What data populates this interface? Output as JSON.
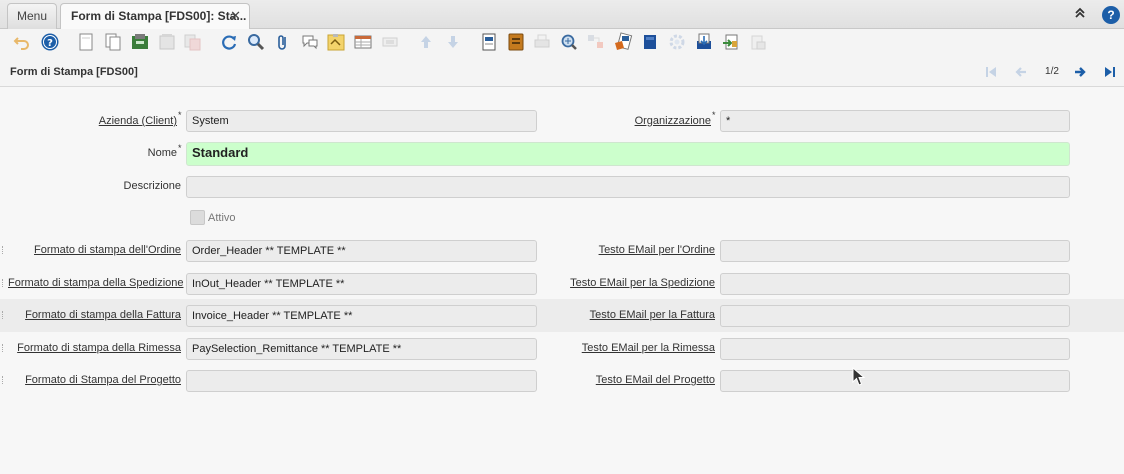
{
  "tabs": {
    "menu": "Menu",
    "active": "Form di Stampa [FDS00]: Sta...",
    "close": "✕"
  },
  "topbar": {
    "collapse_icon": "double-chevron-up-icon",
    "help_icon": "?"
  },
  "toolbar": {
    "icons": [
      "undo-icon",
      "help-icon",
      "new-record-icon",
      "copy-record-icon",
      "save-icon",
      "delete-icon",
      "delete-selection-icon",
      "refresh-icon",
      "find-icon",
      "attachment-icon",
      "chat-icon",
      "post-it-icon",
      "grid-toggle-icon",
      "multi-edit-icon",
      "parent-record-icon",
      "detail-record-icon",
      "report-icon",
      "archive-icon",
      "print-icon",
      "zoom-across-icon",
      "active-workflows-icon",
      "requests-icon",
      "product-info-icon",
      "customize-icon",
      "export-icon",
      "import-icon",
      "lock-icon"
    ]
  },
  "header": {
    "title": "Form di Stampa [FDS00]",
    "record_indicator": "1/2"
  },
  "form": {
    "client": {
      "label": "Azienda (Client)",
      "value": "System"
    },
    "organization": {
      "label": "Organizzazione",
      "value": "*"
    },
    "name": {
      "label": "Nome",
      "value": "Standard"
    },
    "description": {
      "label": "Descrizione",
      "value": ""
    },
    "active": {
      "label": "Attivo",
      "checked": false
    },
    "order_format": {
      "label": "Formato di stampa dell'Ordine",
      "value": "Order_Header  ** TEMPLATE **"
    },
    "order_email": {
      "label": "Testo EMail per l'Ordine",
      "value": ""
    },
    "shipment_format": {
      "label": "Formato di stampa della Spedizione",
      "value": "InOut_Header ** TEMPLATE **"
    },
    "shipment_email": {
      "label": "Testo EMail per la Spedizione",
      "value": ""
    },
    "invoice_format": {
      "label": "Formato di stampa della Fattura",
      "value": "Invoice_Header  ** TEMPLATE **"
    },
    "invoice_email": {
      "label": "Testo EMail per la Fattura",
      "value": ""
    },
    "remittance_format": {
      "label": "Formato di stampa della Rimessa",
      "value": "PaySelection_Remittance  ** TEMPLATE **"
    },
    "remittance_email": {
      "label": "Testo EMail per la Rimessa",
      "value": ""
    },
    "project_format": {
      "label": "Formato di Stampa del Progetto",
      "value": ""
    },
    "project_email": {
      "label": "Testo EMail del Progetto",
      "value": ""
    },
    "required_mark": "*"
  }
}
